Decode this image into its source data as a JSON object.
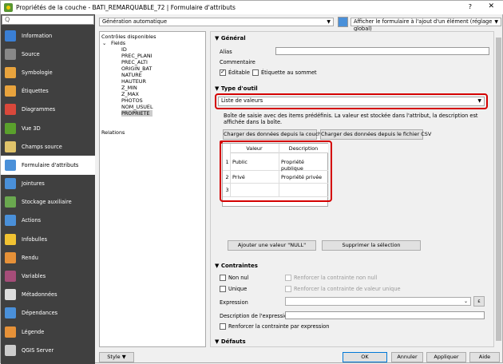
{
  "title": "Propriétés de la couche - BATI_REMARQUABLE_72 | Formulaire d'attributs",
  "help": "?",
  "close": "✕",
  "search_placeholder": "Q",
  "nav": [
    {
      "label": "Information",
      "color": "#3a7fd5"
    },
    {
      "label": "Source",
      "color": "#888"
    },
    {
      "label": "Symbologie",
      "color": "#e8a33d"
    },
    {
      "label": "Étiquettes",
      "color": "#e8a33d"
    },
    {
      "label": "Diagrammes",
      "color": "#d9483b"
    },
    {
      "label": "Vue 3D",
      "color": "#5aa02c"
    },
    {
      "label": "Champs source",
      "color": "#e0c36a"
    },
    {
      "label": "Formulaire d'attributs",
      "color": "#4a90d9"
    },
    {
      "label": "Jointures",
      "color": "#4a90d9"
    },
    {
      "label": "Stockage auxiliaire",
      "color": "#6aa84f"
    },
    {
      "label": "Actions",
      "color": "#4a90d9"
    },
    {
      "label": "Infobulles",
      "color": "#f1c232"
    },
    {
      "label": "Rendu",
      "color": "#e69138"
    },
    {
      "label": "Variables",
      "color": "#a64d79"
    },
    {
      "label": "Métadonnées",
      "color": "#ddd"
    },
    {
      "label": "Dépendances",
      "color": "#4a90d9"
    },
    {
      "label": "Légende",
      "color": "#e69138"
    },
    {
      "label": "QGIS Server",
      "color": "#ccc"
    }
  ],
  "layout_combo": "Génération automatique",
  "form_combo": "Afficher le formulaire à l'ajout d'un élément (réglage global)",
  "tree": {
    "root": "Contrôles disponibles",
    "fields": "Fields",
    "items": [
      "ID",
      "PREC_PLANI",
      "PREC_ALTI",
      "ORIGIN_BAT",
      "NATURE",
      "HAUTEUR",
      "Z_MIN",
      "Z_MAX",
      "PHOTOS",
      "NOM_USUEL",
      "PROPRIETE"
    ],
    "relations": "Relations"
  },
  "general": {
    "title": "Général",
    "alias": "Alias",
    "comment": "Commentaire",
    "editable": "Éditable",
    "label_top": "Étiquette au sommet"
  },
  "widget": {
    "title": "Type d'outil",
    "type": "Liste de valeurs",
    "desc": "Boîte de saisie avec des items prédéfinis. La valeur est stockée dans l'attribut, la description est affichée dans la boîte.",
    "load_layer": "Charger des données depuis la couche",
    "load_csv": "Charger des données depuis le fichier CSV",
    "col_value": "Valeur",
    "col_desc": "Description",
    "rows": [
      {
        "n": "1",
        "value": "Public",
        "desc": "Propriété publique"
      },
      {
        "n": "2",
        "value": "Privé",
        "desc": "Propriété privée"
      },
      {
        "n": "3",
        "value": "",
        "desc": ""
      }
    ],
    "add_null": "Ajouter une valeur \"NULL\"",
    "delete_sel": "Supprimer la sélection"
  },
  "constraints": {
    "title": "Contraintes",
    "not_null": "Non nul",
    "enforce_not_null": "Renforcer la contrainte non null",
    "unique": "Unique",
    "enforce_unique": "Renforcer la contrainte de valeur unique",
    "expression": "Expression",
    "expr_desc": "Description de l'expression",
    "enforce_expr": "Renforcer la contrainte par expression",
    "epsilon": "ε"
  },
  "defaults": {
    "title": "Défauts"
  },
  "bottom": {
    "style": "Style",
    "ok": "OK",
    "cancel": "Annuler",
    "apply": "Appliquer",
    "help": "Aide"
  }
}
